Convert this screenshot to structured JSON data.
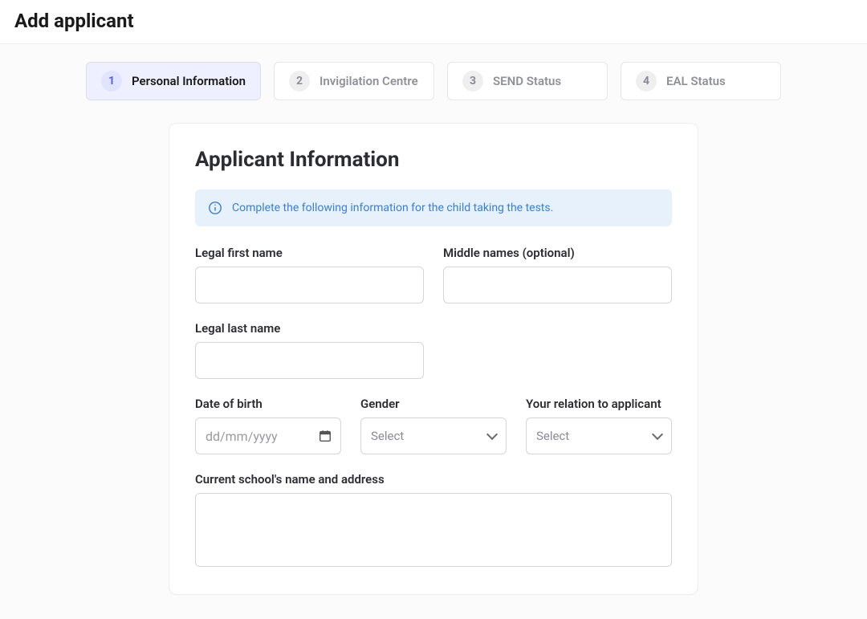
{
  "page_title": "Add applicant",
  "steps": [
    {
      "num": "1",
      "label": "Personal Information"
    },
    {
      "num": "2",
      "label": "Invigilation Centre"
    },
    {
      "num": "3",
      "label": "SEND Status"
    },
    {
      "num": "4",
      "label": "EAL Status"
    }
  ],
  "card": {
    "title": "Applicant Information",
    "banner": "Complete the following information for the child taking the tests."
  },
  "fields": {
    "first_name_label": "Legal first name",
    "middle_names_label": "Middle names (optional)",
    "last_name_label": "Legal last name",
    "dob_label": "Date of birth",
    "dob_placeholder": "dd/mm/yyyy",
    "gender_label": "Gender",
    "gender_placeholder": "Select",
    "relation_label": "Your relation to applicant",
    "relation_placeholder": "Select",
    "school_label": "Current school's name and address"
  }
}
